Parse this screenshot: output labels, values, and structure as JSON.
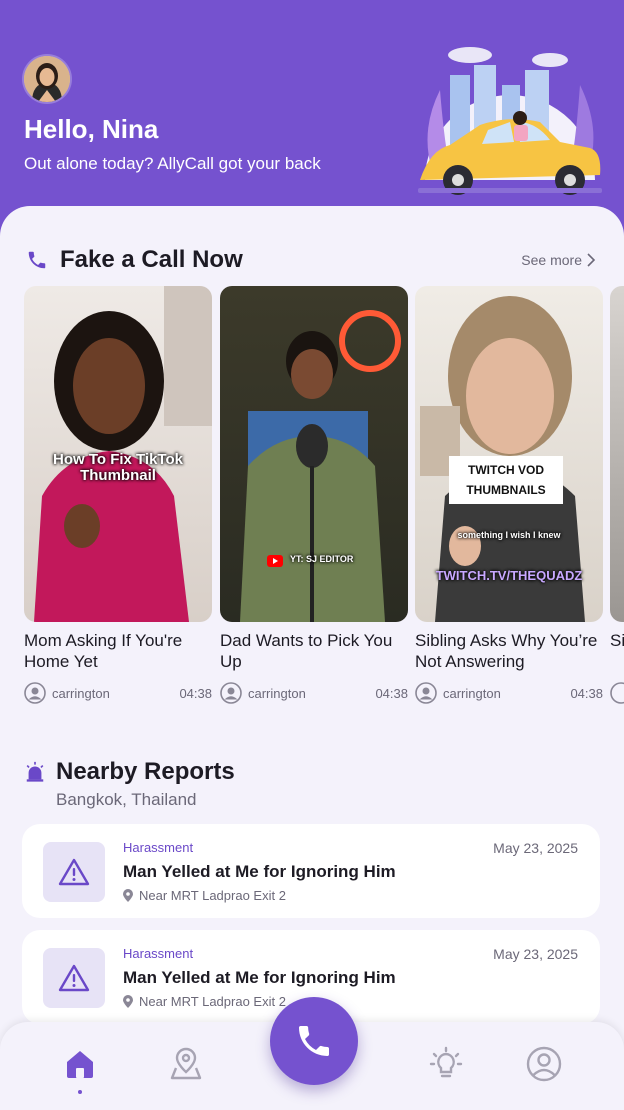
{
  "header": {
    "greeting": "Hello, Nina",
    "subtitle": "Out alone today? AllyCall got your back"
  },
  "fake_call": {
    "title": "Fake a Call Now",
    "see_more": "See more",
    "cards": [
      {
        "title": "Mom Asking If You're Home Yet",
        "author": "carrington",
        "duration": "04:38",
        "overlay": "How To Fix TikTok Thumbnail"
      },
      {
        "title": "Dad Wants to Pick You Up",
        "author": "carrington",
        "duration": "04:38",
        "overlay": "YT: SJ EDITOR"
      },
      {
        "title": "Sibling Asks Why You’re Not Answering",
        "author": "carrington",
        "duration": "04:38",
        "overlay": "TWITCH VOD THUMBNAILS",
        "overlay2": "something I wish I knew",
        "overlay3": "TWITCH.TV/THEQUADZ"
      },
      {
        "title": "Si Yo",
        "author": "",
        "duration": "",
        "overlay": ""
      }
    ]
  },
  "reports": {
    "title": "Nearby Reports",
    "location": "Bangkok, Thailand",
    "items": [
      {
        "category": "Harassment",
        "date": "May 23, 2025",
        "title": "Man Yelled at Me for Ignoring Him",
        "location": "Near MRT Ladprao Exit 2"
      },
      {
        "category": "Harassment",
        "date": "May 23, 2025",
        "title": "Man Yelled at Me for Ignoring Him",
        "location": "Near MRT Ladprao Exit 2"
      }
    ]
  },
  "nav": {
    "items": [
      "home-icon",
      "map-pin-icon",
      "phone-icon",
      "lightbulb-icon",
      "profile-icon"
    ],
    "active": "home-icon",
    "accent": "#7552cf"
  }
}
